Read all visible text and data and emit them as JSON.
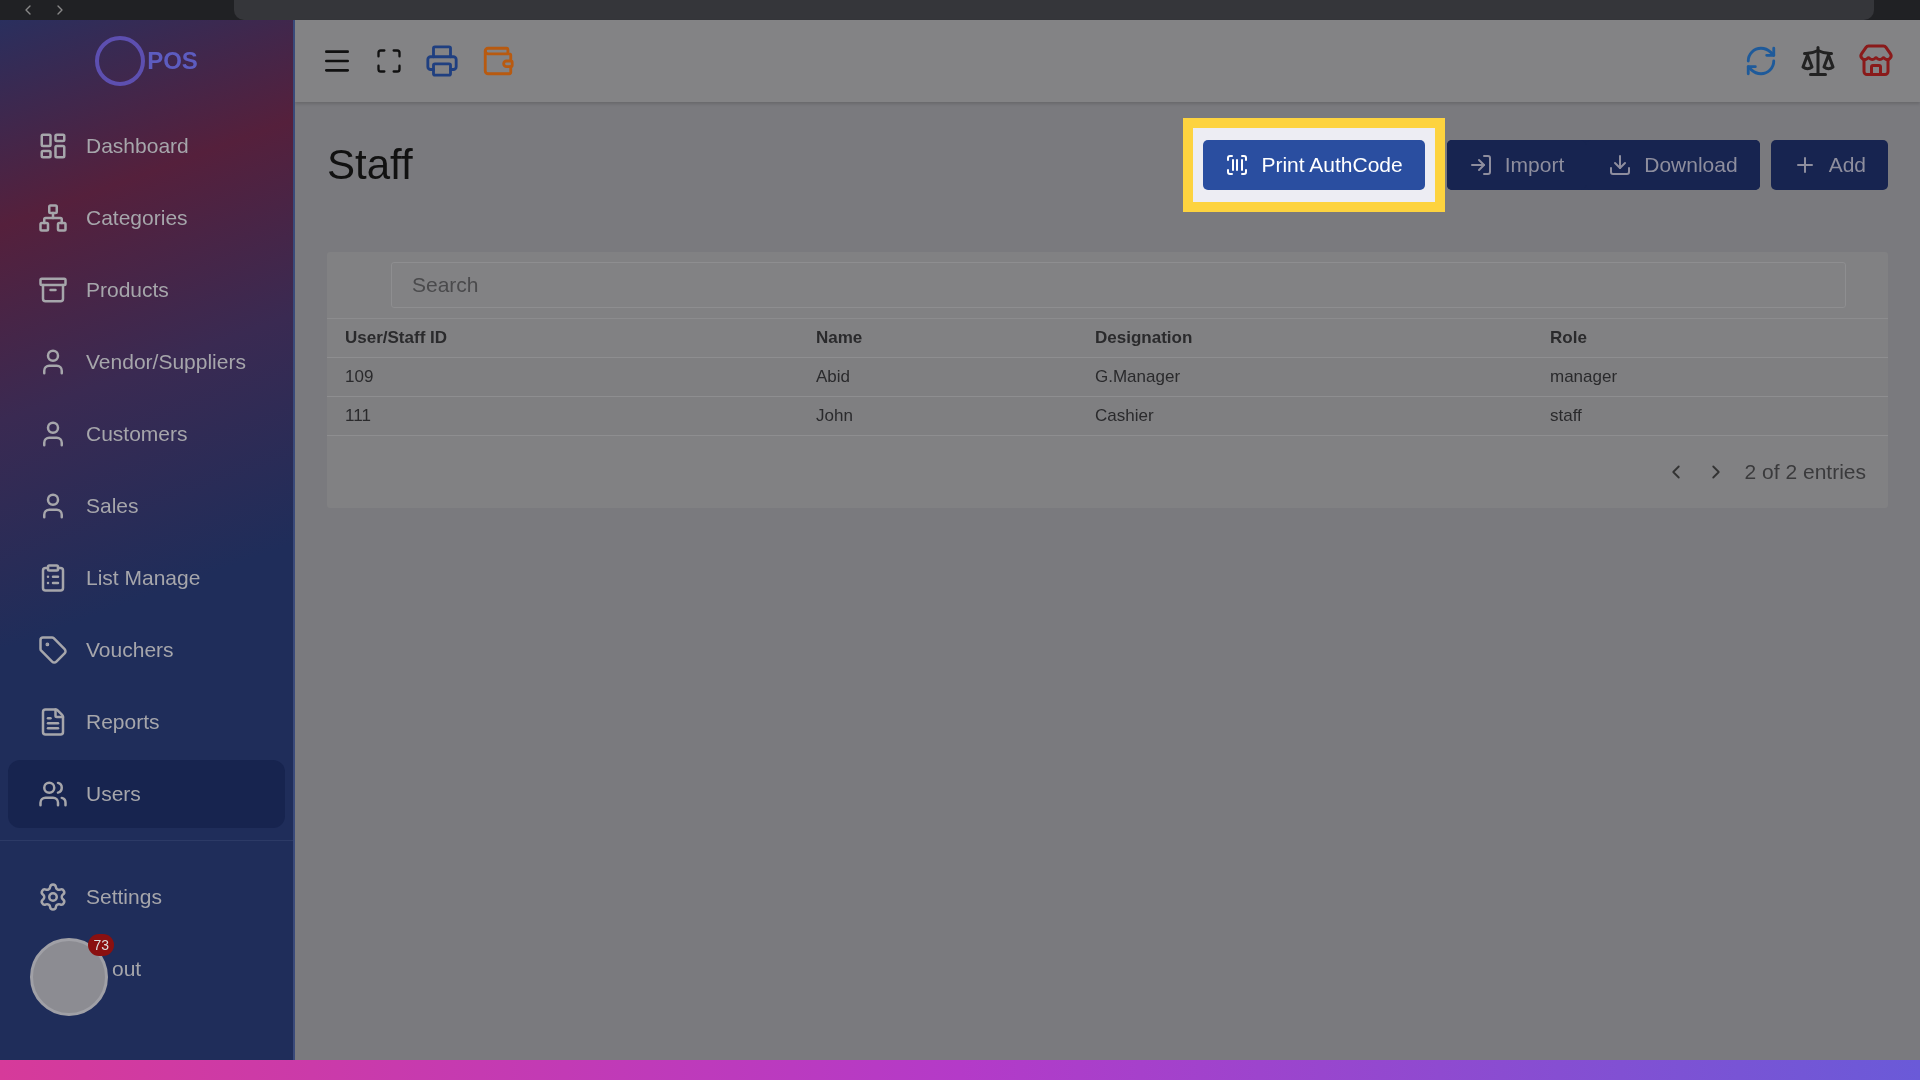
{
  "sidebar": {
    "logo": "POS",
    "items": [
      {
        "label": "Dashboard",
        "selected": false
      },
      {
        "label": "Categories",
        "selected": false
      },
      {
        "label": "Products",
        "selected": false
      },
      {
        "label": "Vendor/Suppliers",
        "selected": false
      },
      {
        "label": "Customers",
        "selected": false
      },
      {
        "label": "Sales",
        "selected": false
      },
      {
        "label": "List Manage",
        "selected": false
      },
      {
        "label": "Vouchers",
        "selected": false
      },
      {
        "label": "Reports",
        "selected": false
      },
      {
        "label": "Users",
        "selected": true
      }
    ],
    "bottom_items": [
      "Settings",
      "out"
    ]
  },
  "floating_button": {
    "badge": "73"
  },
  "page": {
    "title": "Staff",
    "actions": [
      {
        "label": "Print AuthCode",
        "highlighted": true
      },
      {
        "label": "Import",
        "highlighted": false
      },
      {
        "label": "Download",
        "highlighted": false
      },
      {
        "label": "Add",
        "highlighted": false
      }
    ]
  },
  "search": {
    "placeholder": "Search"
  },
  "table": {
    "columns": [
      "User/Staff ID",
      "Name",
      "Designation",
      "Role"
    ],
    "rows": [
      [
        "109",
        "Abid",
        "G.Manager",
        "manager"
      ],
      [
        "111",
        "John",
        "Cashier",
        "staff"
      ]
    ]
  },
  "pagination": {
    "summary": "2 of 2 entries"
  }
}
